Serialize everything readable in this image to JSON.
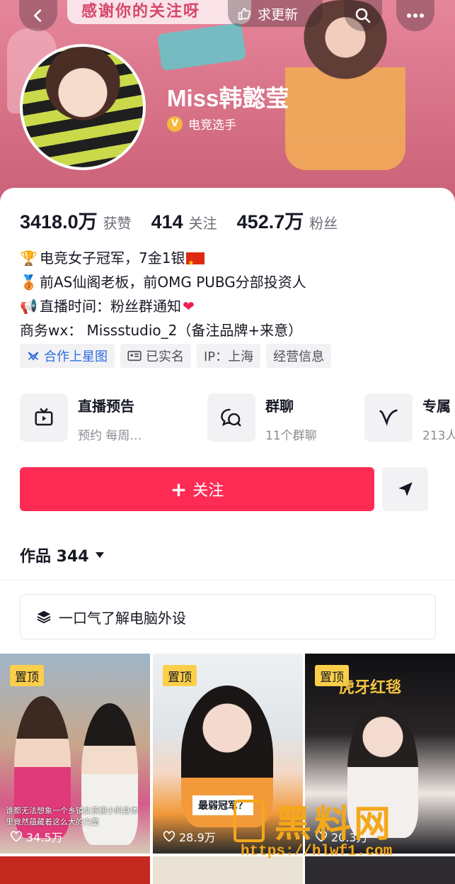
{
  "header": {
    "banner_text": "感谢你的关注呀",
    "update_label": "求更新",
    "username": "Miss韩懿莹",
    "verify_badge": "V",
    "verify_label": "电竞选手"
  },
  "stats": [
    {
      "value": "3418.0万",
      "label": "获赞"
    },
    {
      "value": "414",
      "label": "关注"
    },
    {
      "value": "452.7万",
      "label": "粉丝"
    }
  ],
  "bio": [
    "电竞女子冠军，7金1银",
    "前AS仙阁老板，前OMG PUBG分部投资人",
    "直播时间：粉丝群通知",
    "商务wx： Missstudio_2（备注品牌+来意）"
  ],
  "tags": [
    {
      "label": "合作上星图",
      "icon": "star-map-icon"
    },
    {
      "label": "已实名",
      "icon": "id-card-icon"
    },
    {
      "label": "IP：上海"
    },
    {
      "label": "经营信息"
    }
  ],
  "features": [
    {
      "title": "直播预告",
      "sub": "预约 每周…",
      "icon": "tv-icon"
    },
    {
      "title": "群聊",
      "sub": "11个群聊",
      "icon": "chat-icon"
    },
    {
      "title": "专属",
      "sub": "213人",
      "icon": "check-icon"
    }
  ],
  "actions": {
    "follow_label": "关注",
    "follow_plus": "+"
  },
  "works": {
    "label": "作品 344",
    "collection_label": "一口气了解电脑外设"
  },
  "videos": [
    {
      "pin": "置顶",
      "likes": "34.5万",
      "caption": "谁都无法想象一个乡镇女孩瘦小的身体里竟然蕴藏着这么大的力量"
    },
    {
      "pin": "置顶",
      "likes": "28.9万",
      "caption": "最弱冠军？"
    },
    {
      "pin": "置顶",
      "likes": "20.3万",
      "caption": "虎牙红毯"
    }
  ],
  "watermark": {
    "text": "黑料网",
    "url": "https://hlwf1.com"
  },
  "colors": {
    "accent": "#fe2c55",
    "banner": "#d97489",
    "pin_badge": "#fbcf4a",
    "watermark": "#f3a81a"
  }
}
